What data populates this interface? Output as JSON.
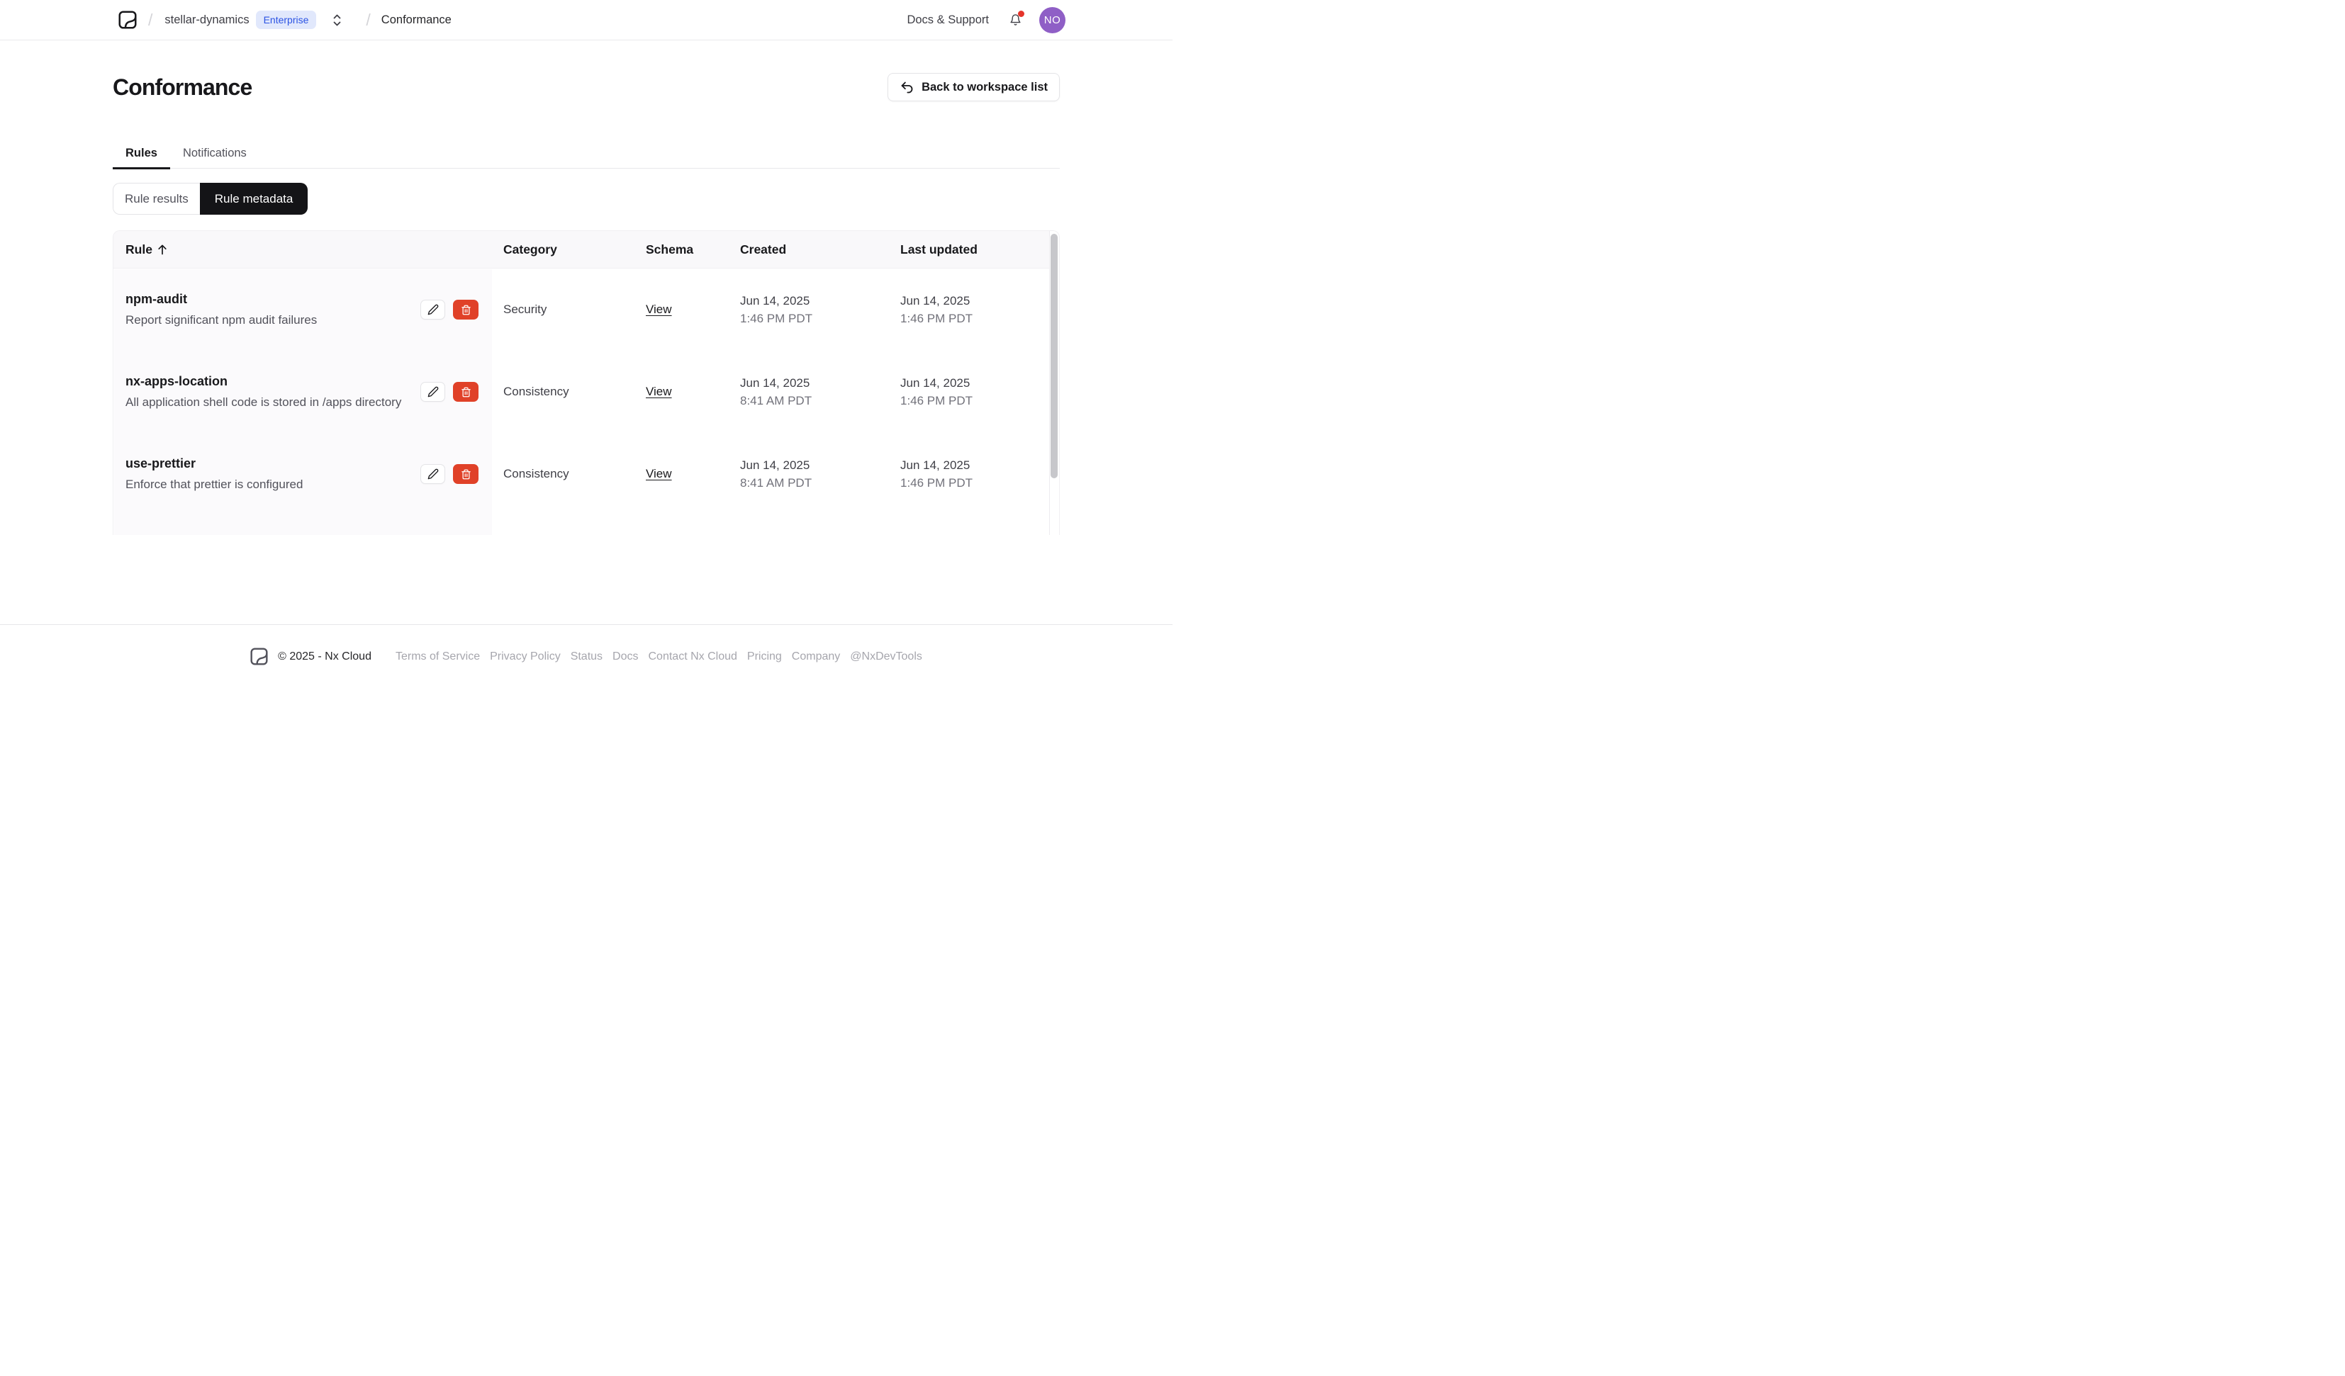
{
  "header": {
    "separator": "/",
    "workspace": "stellar-dynamics",
    "workspace_badge": "Enterprise",
    "current_page": "Conformance",
    "docs_support": "Docs & Support",
    "avatar_initials": "NO"
  },
  "page": {
    "title": "Conformance",
    "back_button": "Back to workspace list"
  },
  "tabs": {
    "rules": "Rules",
    "notifications": "Notifications"
  },
  "view_toggle": {
    "rule_results": "Rule results",
    "rule_metadata": "Rule metadata",
    "selected": "Rule metadata"
  },
  "table": {
    "columns": [
      "Rule",
      "Category",
      "Schema",
      "Created",
      "Last updated"
    ],
    "sort_column": "Rule",
    "sort_direction": "ascending",
    "rows": [
      {
        "name": "npm-audit",
        "description": "Report significant npm audit failures",
        "category": "Security",
        "schema_link": "View",
        "created_date": "Jun 14, 2025",
        "created_time": "1:46 PM PDT",
        "updated_date": "Jun 14, 2025",
        "updated_time": "1:46 PM PDT"
      },
      {
        "name": "nx-apps-location",
        "description": "All application shell code is stored in /apps directory",
        "category": "Consistency",
        "schema_link": "View",
        "created_date": "Jun 14, 2025",
        "created_time": "8:41 AM PDT",
        "updated_date": "Jun 14, 2025",
        "updated_time": "1:46 PM PDT"
      },
      {
        "name": "use-prettier",
        "description": "Enforce that prettier is configured",
        "category": "Consistency",
        "schema_link": "View",
        "created_date": "Jun 14, 2025",
        "created_time": "8:41 AM PDT",
        "updated_date": "Jun 14, 2025",
        "updated_time": "1:46 PM PDT"
      }
    ]
  },
  "footer": {
    "copyright": "© 2025 - Nx Cloud",
    "links": [
      "Terms of Service",
      "Privacy Policy",
      "Status",
      "Docs",
      "Contact Nx Cloud",
      "Pricing",
      "Company",
      "@NxDevTools"
    ]
  },
  "colors": {
    "accent_blue": "#2b53e3",
    "badge_bg": "#e1e8fc",
    "danger_red": "#e04128",
    "avatar_purple": "#8f5fc6",
    "notification_dot": "#e5342a",
    "selected_segment": "#141417"
  }
}
